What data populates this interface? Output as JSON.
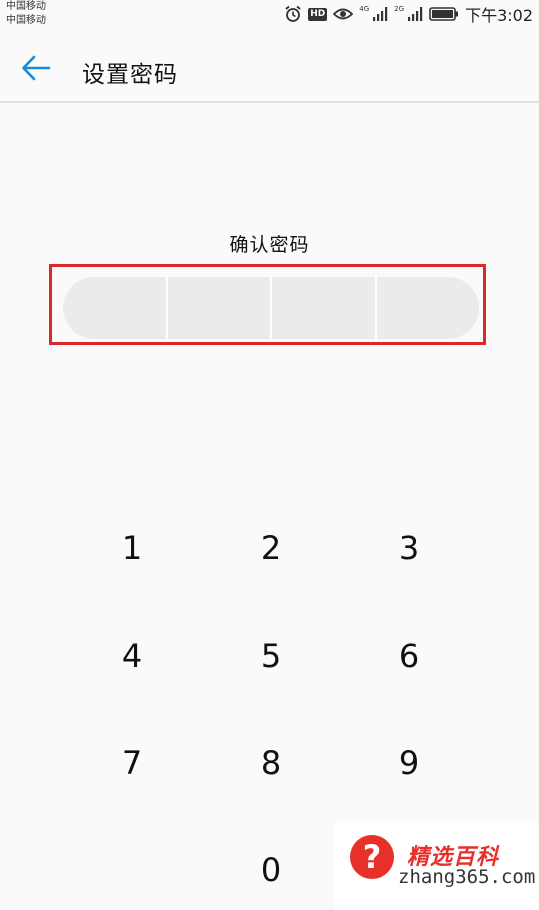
{
  "status_bar": {
    "carrier_1": "中国移动",
    "carrier_2": "中国移动",
    "hd_badge": "HD",
    "net_1": "4G",
    "net_2": "2G",
    "time": "下午3:02",
    "icons": [
      "alarm-icon",
      "eye-icon",
      "signal-icon",
      "battery-icon"
    ]
  },
  "header": {
    "back_icon": "arrow-left-icon",
    "title": "设置密码",
    "accent_color": "#1a8ad6"
  },
  "main": {
    "prompt": "确认密码",
    "pin_length": 4,
    "highlight_color": "#d9292a"
  },
  "keypad": {
    "keys": [
      "1",
      "2",
      "3",
      "4",
      "5",
      "6",
      "7",
      "8",
      "9",
      "0"
    ]
  },
  "watermark": {
    "symbol": "?",
    "brand": "精选百科",
    "url": "zhang365.com",
    "color": "#e8302a"
  }
}
